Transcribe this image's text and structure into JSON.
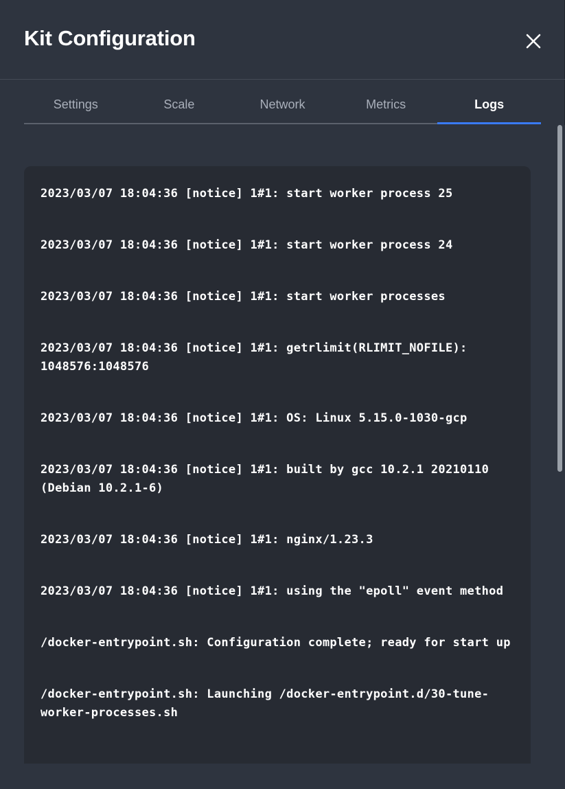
{
  "dialog": {
    "title": "Kit Configuration",
    "close_icon": "close-icon"
  },
  "tabs": [
    {
      "label": "Settings",
      "active": false
    },
    {
      "label": "Scale",
      "active": false
    },
    {
      "label": "Network",
      "active": false
    },
    {
      "label": "Metrics",
      "active": false
    },
    {
      "label": "Logs",
      "active": true
    }
  ],
  "colors": {
    "background": "#2e343f",
    "panel": "#272b33",
    "accent": "#3a7bf6",
    "tab_inactive": "#a9afba"
  },
  "logs": [
    "2023/03/07 18:04:36 [notice] 1#1: start worker process 25",
    "2023/03/07 18:04:36 [notice] 1#1: start worker process 24",
    "2023/03/07 18:04:36 [notice] 1#1: start worker processes",
    "2023/03/07 18:04:36 [notice] 1#1: getrlimit(RLIMIT_NOFILE): 1048576:1048576",
    "2023/03/07 18:04:36 [notice] 1#1: OS: Linux 5.15.0-1030-gcp",
    "2023/03/07 18:04:36 [notice] 1#1: built by gcc 10.2.1 20210110 (Debian 10.2.1-6)",
    "2023/03/07 18:04:36 [notice] 1#1: nginx/1.23.3",
    "2023/03/07 18:04:36 [notice] 1#1: using the \"epoll\" event method",
    "/docker-entrypoint.sh: Configuration complete; ready for start up",
    "/docker-entrypoint.sh: Launching /docker-entrypoint.d/30-tune-worker-processes.sh"
  ]
}
